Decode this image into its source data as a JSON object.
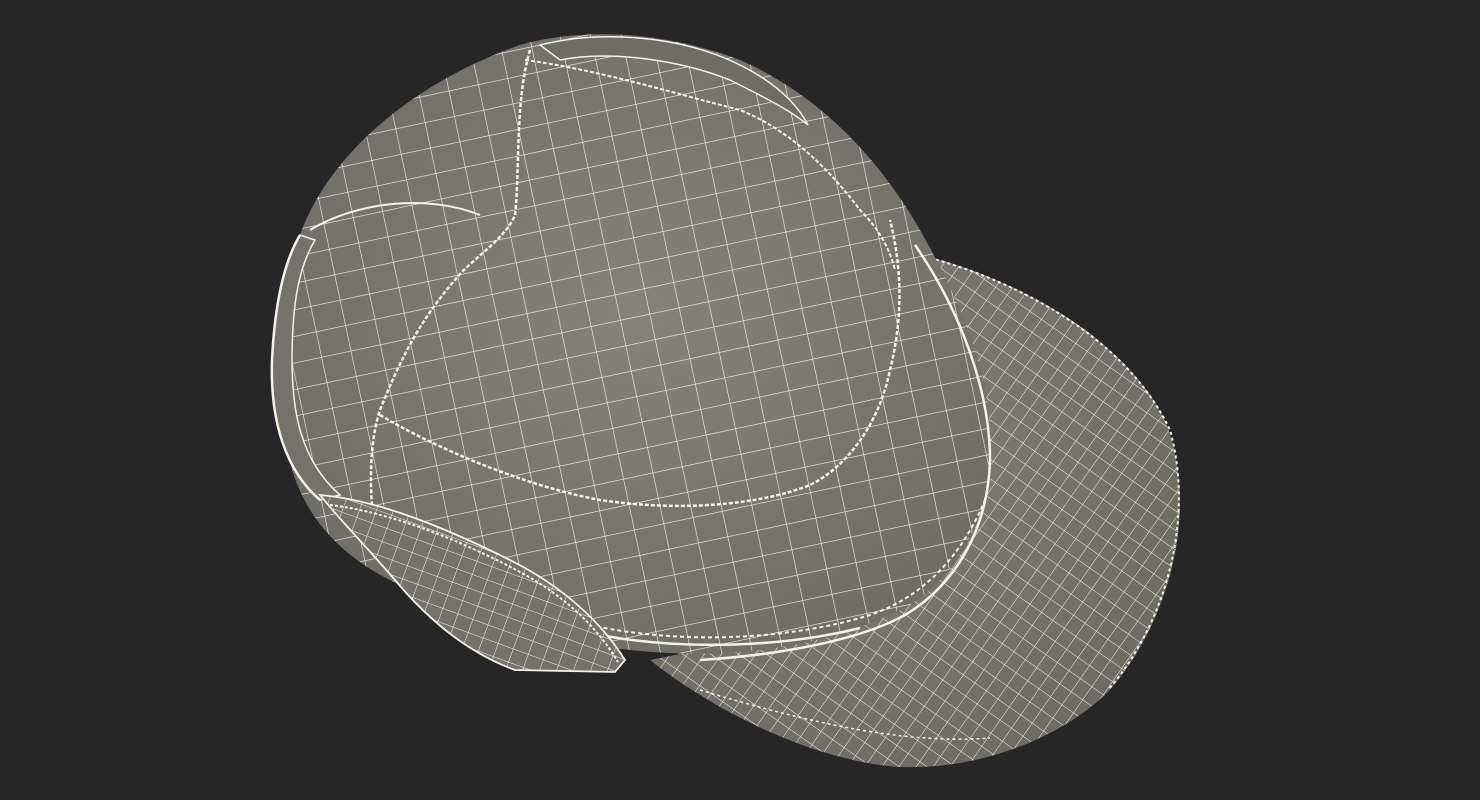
{
  "scene": {
    "subject_icon": "cap-wireframe-icon",
    "colors": {
      "background": "#262626",
      "surface": "#7e7e72",
      "surface_dark": "#6f6f64",
      "wire": "#f4f3e6"
    }
  }
}
